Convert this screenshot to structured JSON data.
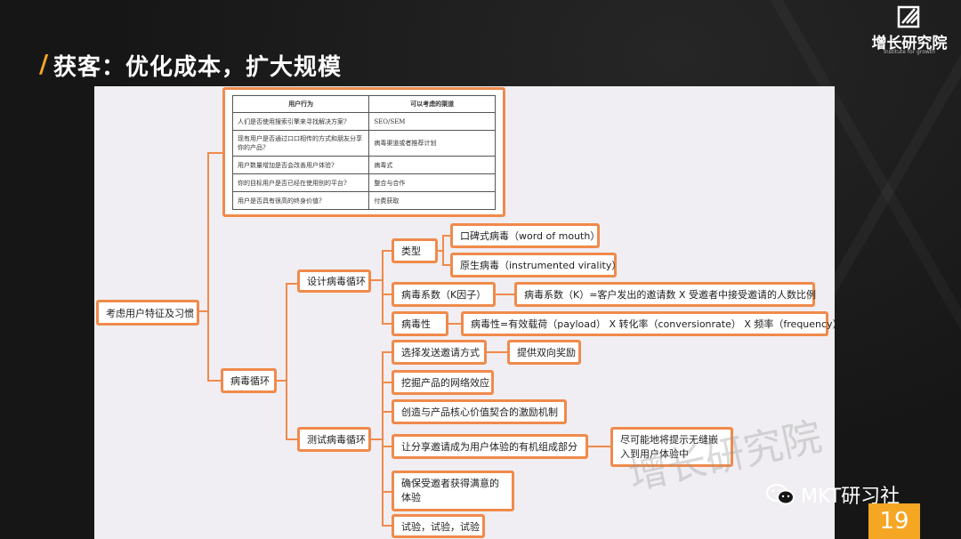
{
  "header": {
    "slash": "/",
    "title": "获客：优化成本，扩大规模"
  },
  "logo": {
    "name": "增长研究院",
    "subtitle": "Institute for growth"
  },
  "table": {
    "headers": [
      "用户行为",
      "可以考虑的渠道"
    ],
    "rows": [
      [
        "人们是否使用搜索引擎来寻找解决方案?",
        "SEO/SEM"
      ],
      [
        "现有用户是否通过口口相传的方式和朋友分享你的产品?",
        "病毒渠道或者推荐计划"
      ],
      [
        "用户数量增加是否会改善用户体验?",
        "病毒式"
      ],
      [
        "你的目标用户是否已经在使用别的平台?",
        "整合与合作"
      ],
      [
        "用户是否具有很高的终身价值?",
        "付费获取"
      ]
    ]
  },
  "nodes": {
    "root": "考虑用户特征及习惯",
    "viral_loop": "病毒循环",
    "design_loop": "设计病毒循环",
    "test_loop": "测试病毒循环",
    "types": "类型",
    "type_wom": "口碑式病毒（word of mouth）",
    "type_native": "原生病毒（instrumented virality）",
    "k_factor": "病毒系数（K因子）",
    "k_factor_def": "病毒系数（K）=客户发出的邀请数 X 受邀者中接受邀请的人数比例",
    "virality": "病毒性",
    "virality_def": "病毒性=有效载荷（payload） X 转化率（conversionrate） X 频率（frequency）",
    "choose_invite": "选择发送邀请方式",
    "two_way_reward": "提供双向奖励",
    "network_effect": "挖掘产品的网络效应",
    "incentive": "创造与产品核心价值契合的激励机制",
    "share_invite": "让分享邀请成为用户体验的有机组成部分",
    "seamless": "尽可能地将提示无缝嵌入到用户体验中",
    "satisfied": "确保受邀者获得满意的体验",
    "try": "试验，试验，试验"
  },
  "watermark": "增长研究院",
  "footer": {
    "wechat": "MKT研习社",
    "page_number": "19"
  },
  "colors": {
    "accent": "#f5a623",
    "node_border": "#f08a4b",
    "background": "#161616",
    "panel": "#f0eef2"
  }
}
